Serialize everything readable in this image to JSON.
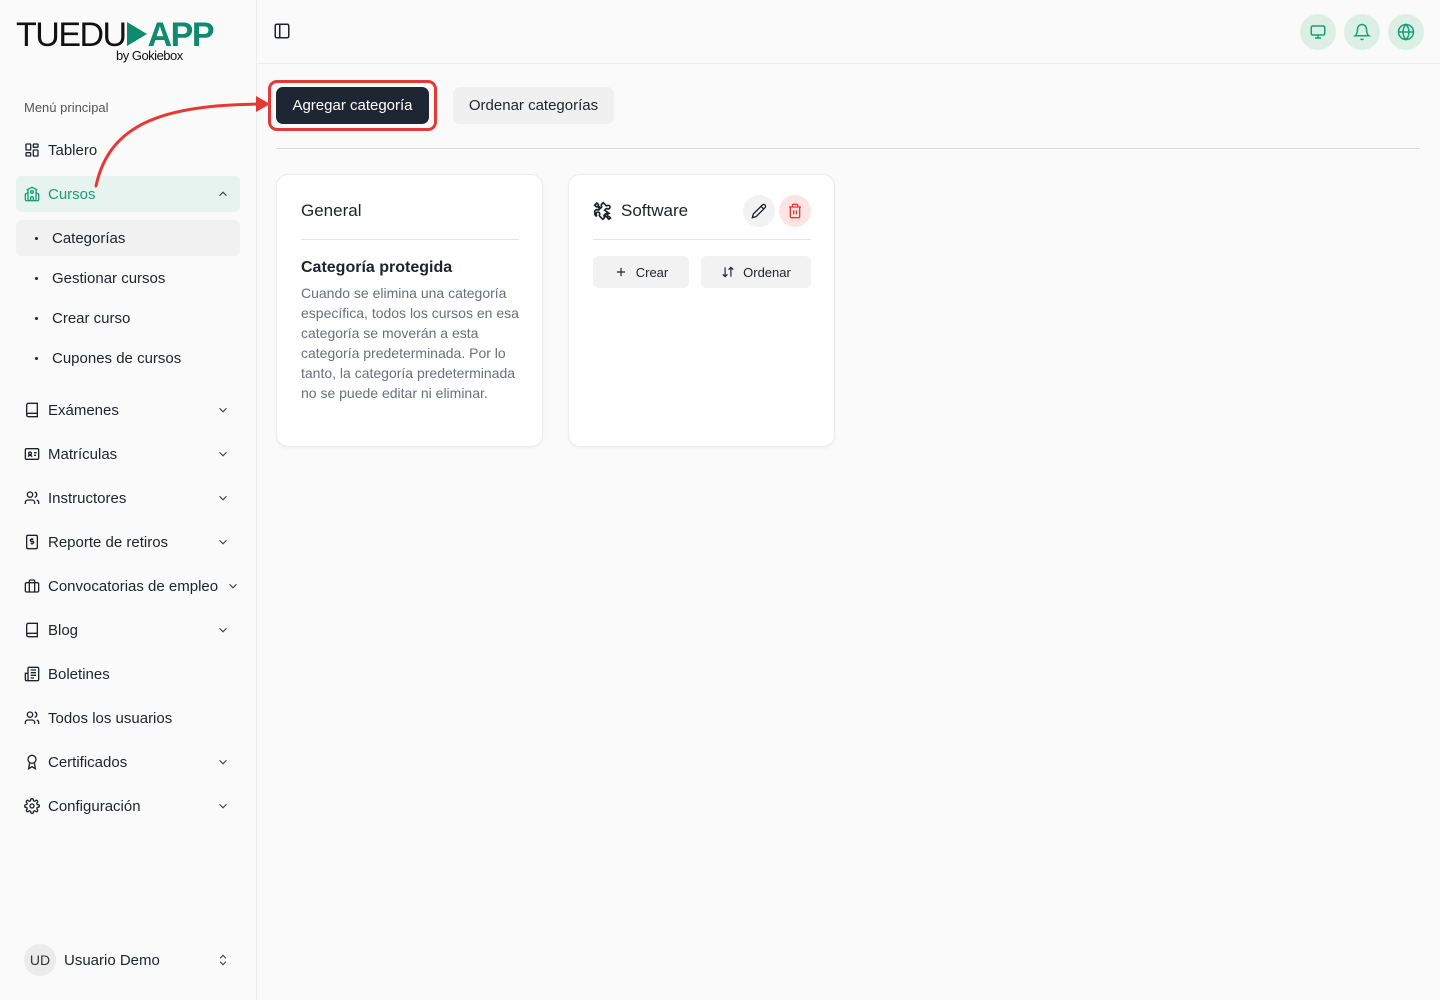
{
  "brand": {
    "word1": "TUEDU",
    "word2": "APP",
    "byline": "by Gokiebox"
  },
  "sidebar": {
    "section_label": "Menú principal",
    "items": [
      {
        "label": "Tablero",
        "icon": "dashboard-icon"
      },
      {
        "label": "Cursos",
        "icon": "school-icon",
        "expanded": true
      },
      {
        "label": "Exámenes",
        "icon": "book-icon"
      },
      {
        "label": "Matrículas",
        "icon": "id-card-icon"
      },
      {
        "label": "Instructores",
        "icon": "users-icon"
      },
      {
        "label": "Reporte de retiros",
        "icon": "receipt-icon"
      },
      {
        "label": "Convocatorias de empleo",
        "icon": "briefcase-icon"
      },
      {
        "label": "Blog",
        "icon": "book-icon"
      },
      {
        "label": "Boletines",
        "icon": "newspaper-icon"
      },
      {
        "label": "Todos los usuarios",
        "icon": "users-icon"
      },
      {
        "label": "Certificados",
        "icon": "award-icon"
      },
      {
        "label": "Configuración",
        "icon": "gear-icon"
      }
    ],
    "cursos_sub": [
      {
        "label": "Categorías",
        "selected": true
      },
      {
        "label": "Gestionar cursos"
      },
      {
        "label": "Crear curso"
      },
      {
        "label": "Cupones de cursos"
      }
    ],
    "user": {
      "initials": "UD",
      "name": "Usuario Demo"
    }
  },
  "toolbar": {
    "add_category": "Agregar categoría",
    "sort_categories": "Ordenar categorías"
  },
  "cards": {
    "general": {
      "title": "General",
      "protected_title": "Categoría protegida",
      "protected_desc": "Cuando se elimina una categoría específica, todos los cursos en esa categoría se moverán a esta categoría predeterminada. Por lo tanto, la categoría predeterminada no se puede editar ni eliminar."
    },
    "software": {
      "title": "Software",
      "create_label": "Crear",
      "sort_label": "Ordenar"
    }
  },
  "colors": {
    "accent": "#16a075",
    "brand_green": "#0e8a6c",
    "primary_button": "#1e2633",
    "highlight": "#e53935",
    "delete": "#e53935"
  }
}
